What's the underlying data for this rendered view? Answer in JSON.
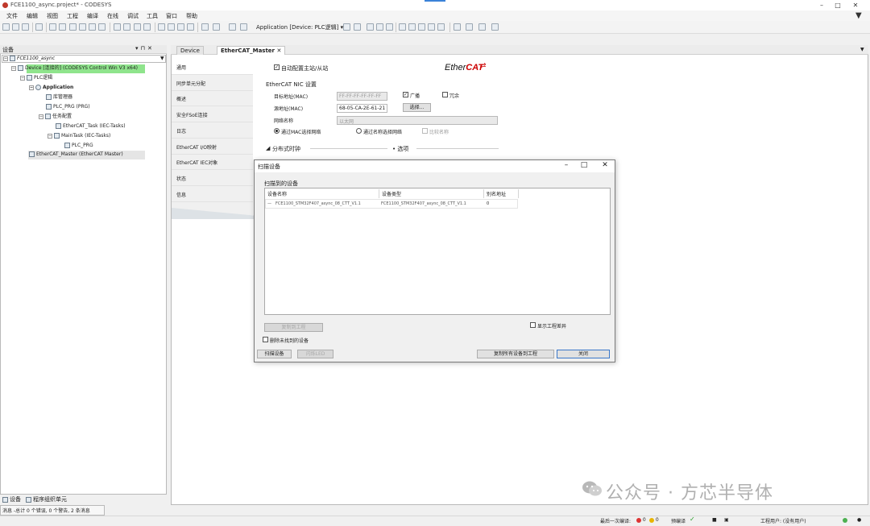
{
  "window": {
    "title": "FCE1100_async.project* - CODESYS"
  },
  "menu": [
    "文件",
    "编辑",
    "视图",
    "工程",
    "编译",
    "在线",
    "调试",
    "工具",
    "窗口",
    "帮助"
  ],
  "toolbar": {
    "application_combo": "Application [Device: PLC逻辑]"
  },
  "device_panel": {
    "title": "设备",
    "tree": {
      "project": "FCE1100_async",
      "device": "Device [连接的] (CODESYS Control Win V3 x64)",
      "plc_logic": "PLC逻辑",
      "application": "Application",
      "library_manager": "库管理器",
      "plc_prg": "PLC_PRG (PRG)",
      "task_config": "任务配置",
      "ethercat_task": "EtherCAT_Task (IEC-Tasks)",
      "main_task": "MainTask (IEC-Tasks)",
      "plc_prg_call": "PLC_PRG",
      "ethercat_master": "EtherCAT_Master (EtherCAT Master)"
    },
    "bottom_tabs": [
      "设备",
      "程序组织单元"
    ]
  },
  "messages": {
    "summary": "消息 -总计 0 个错误, 0 个警告, 2 条消息"
  },
  "editor": {
    "tabs": [
      "Device",
      "EtherCAT_Master"
    ],
    "nav": [
      "通用",
      "同步单元分配",
      "概述",
      "安全FSoE连接",
      "日志",
      "EtherCAT I/O映射",
      "EtherCAT IEC对象",
      "状态",
      "信息"
    ],
    "general": {
      "auto_config_label": "自动配置主站/从站",
      "auto_config_checked": true,
      "logo_text": "EtherCAT",
      "nic_section": "EtherCAT NIC 设置",
      "dest_mac_label": "目标地址(MAC)",
      "dest_mac_value": "FF-FF-FF-FF-FF-FF",
      "broadcast_label": "广播",
      "broadcast_checked": true,
      "redundancy_label": "冗余",
      "redundancy_checked": false,
      "src_mac_label": "源地址(MAC)",
      "src_mac_value": "68-05-CA-2E-61-21",
      "browse_button": "选择...",
      "network_name_label": "网络名称",
      "network_name_value": "以太网",
      "select_by_mac": "通过MAC选择网络",
      "select_by_name": "通过名称选择网络",
      "compare_name": "比较名称",
      "dc_section": "分布式时钟",
      "options_section": "选项"
    }
  },
  "scan_dialog": {
    "title": "扫描设备",
    "group_label": "扫描到的设备",
    "columns": [
      "设备名称",
      "设备类型",
      "别名地址"
    ],
    "rows": [
      {
        "name": "FCE1100_STM32F407_async_08_CTT_V1.1",
        "type": "FCE1100_STM32F407_async_08_CTT_V1.1",
        "alias": "0"
      }
    ],
    "copy_to_project_button": "复制到工程",
    "show_diff_label": "显示工程差异",
    "delete_unmatched_label": "删除未找到的设备",
    "scan_button": "扫描设备",
    "blink_button": "闪烁LED",
    "copy_all_button": "复制所有设备到工程",
    "close_button": "关闭"
  },
  "watermark": "公众号 · 方芯半导体",
  "status_bar": {
    "last_build": "最后一次编译:",
    "errors": "0",
    "warnings": "0",
    "precompile": "预编译",
    "project_user": "工程用户: (没有用户)"
  }
}
